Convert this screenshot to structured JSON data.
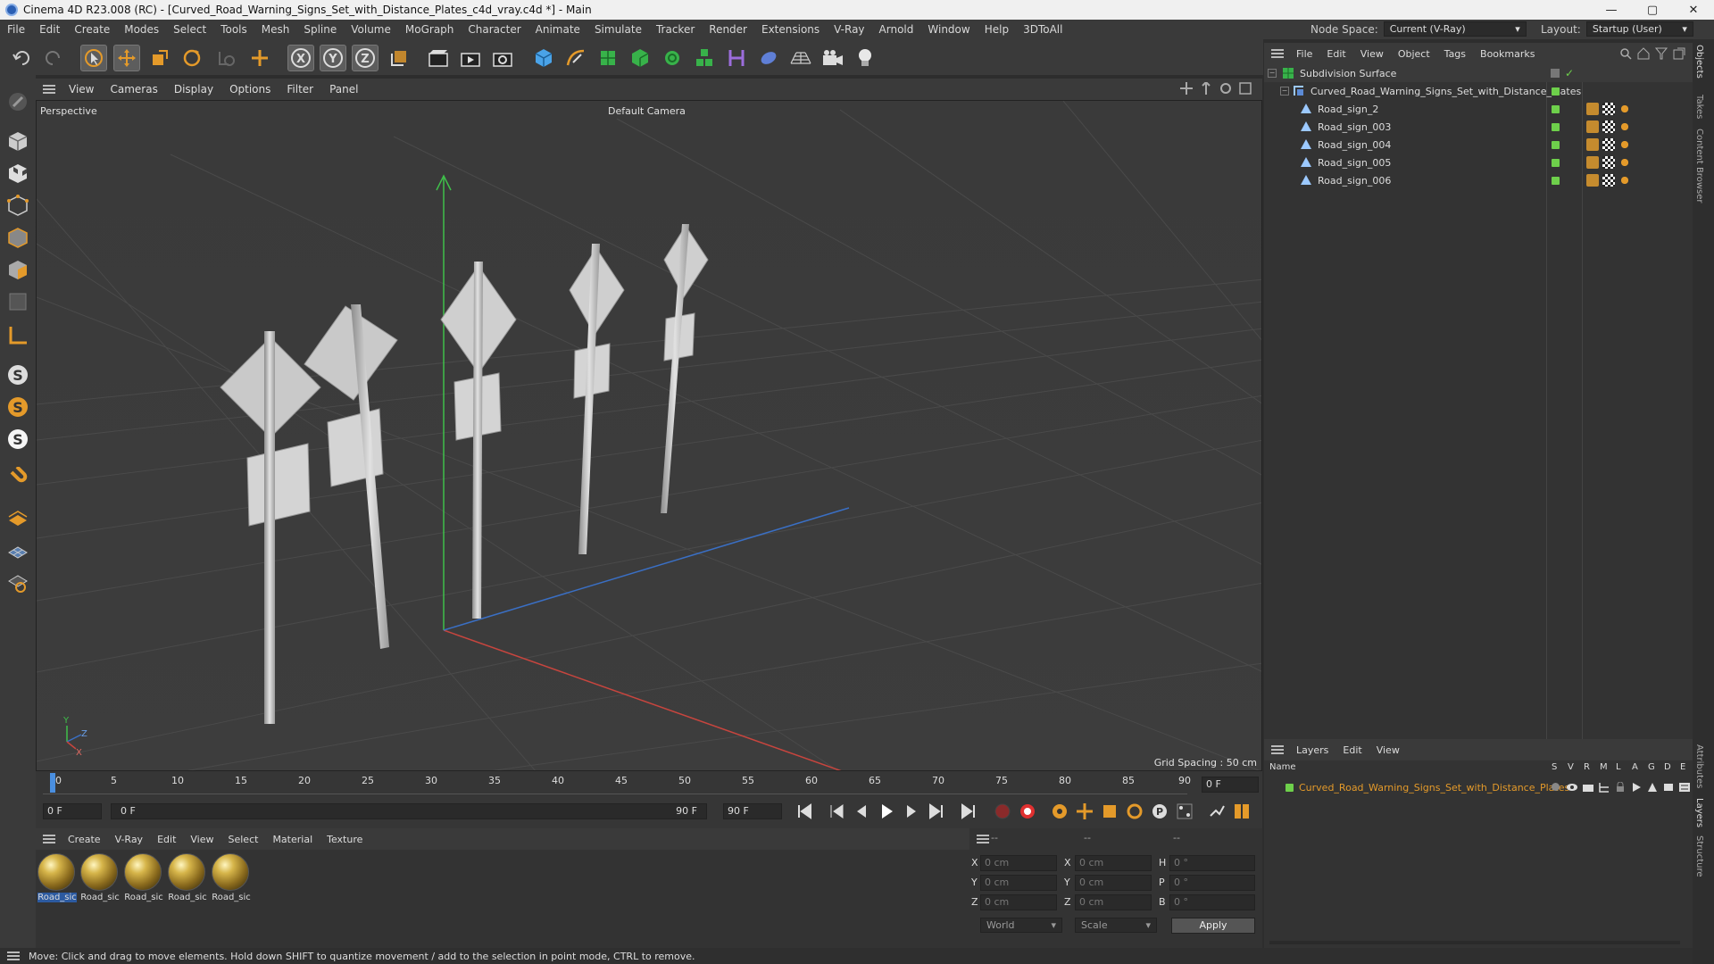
{
  "window": {
    "title": "Cinema 4D R23.008 (RC) - [Curved_Road_Warning_Signs_Set_with_Distance_Plates_c4d_vray.c4d *] - Main",
    "minimize": "—",
    "maximize": "▢",
    "close": "✕"
  },
  "menu": [
    "File",
    "Edit",
    "Create",
    "Modes",
    "Select",
    "Tools",
    "Mesh",
    "Spline",
    "Volume",
    "MoGraph",
    "Character",
    "Animate",
    "Simulate",
    "Tracker",
    "Render",
    "Extensions",
    "V-Ray",
    "Arnold",
    "Window",
    "Help",
    "3DToAll"
  ],
  "node_space": {
    "label": "Node Space:",
    "value": "Current (V-Ray)"
  },
  "layout": {
    "label": "Layout:",
    "value": "Startup (User)"
  },
  "viewport": {
    "menu": [
      "View",
      "Cameras",
      "Display",
      "Options",
      "Filter",
      "Panel"
    ],
    "label": "Perspective",
    "camera": "Default Camera",
    "grid_spacing": "Grid Spacing : 50 cm",
    "axis_y": "Y",
    "axis_z": "Z",
    "axis_x": "X"
  },
  "timeline": {
    "ticks": [
      "0",
      "5",
      "10",
      "15",
      "20",
      "25",
      "30",
      "35",
      "40",
      "45",
      "50",
      "55",
      "60",
      "65",
      "70",
      "75",
      "80",
      "85",
      "90"
    ],
    "current_frame": "0 F",
    "start": "0 F",
    "range_start": "0 F",
    "range_end": "90 F",
    "end": "90 F"
  },
  "materials": {
    "menu": [
      "Create",
      "V-Ray",
      "Edit",
      "View",
      "Select",
      "Material",
      "Texture"
    ],
    "items": [
      "Road_sic",
      "Road_sic",
      "Road_sic",
      "Road_sic",
      "Road_sic"
    ]
  },
  "coords": {
    "header": [
      "--",
      "--",
      "--"
    ],
    "rows": [
      {
        "a": "X",
        "av": "0 cm",
        "b": "X",
        "bv": "0 cm",
        "c": "H",
        "cv": "0 °"
      },
      {
        "a": "Y",
        "av": "0 cm",
        "b": "Y",
        "bv": "0 cm",
        "c": "P",
        "cv": "0 °"
      },
      {
        "a": "Z",
        "av": "0 cm",
        "b": "Z",
        "bv": "0 cm",
        "c": "B",
        "cv": "0 °"
      }
    ],
    "world": "World",
    "scale": "Scale",
    "apply": "Apply"
  },
  "objects": {
    "menu": [
      "File",
      "Edit",
      "View",
      "Object",
      "Tags",
      "Bookmarks"
    ],
    "items": [
      {
        "name": "Subdivision Surface",
        "level": 0
      },
      {
        "name": "Curved_Road_Warning_Signs_Set_with_Distance_Plates",
        "level": 1
      },
      {
        "name": "Road_sign_2",
        "level": 2
      },
      {
        "name": "Road_sign_003",
        "level": 2
      },
      {
        "name": "Road_sign_004",
        "level": 2
      },
      {
        "name": "Road_sign_005",
        "level": 2
      },
      {
        "name": "Road_sign_006",
        "level": 2
      }
    ]
  },
  "layers": {
    "menu": [
      "Layers",
      "Edit",
      "View"
    ],
    "name_header": "Name",
    "cols": [
      "S",
      "V",
      "R",
      "M",
      "L",
      "A",
      "G",
      "D",
      "E"
    ],
    "item": "Curved_Road_Warning_Signs_Set_with_Distance_Plates"
  },
  "sidetabs": [
    "Objects",
    "Takes",
    "Content Browser",
    "Attributes",
    "Layers",
    "Structure"
  ],
  "status": "Move: Click and drag to move elements. Hold down SHIFT to quantize movement / add to the selection in point mode, CTRL to remove."
}
